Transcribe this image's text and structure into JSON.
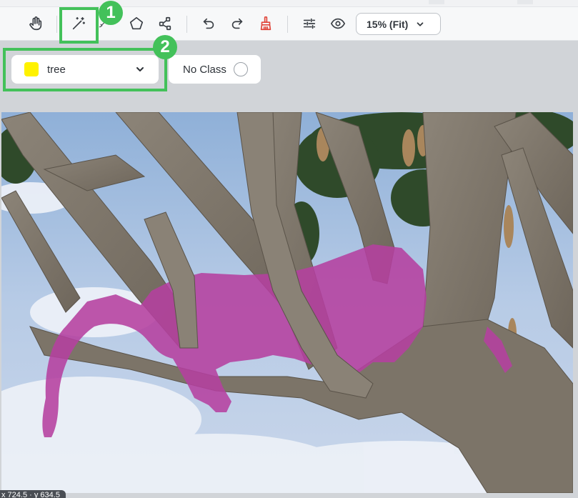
{
  "toolbar": {
    "tools": [
      {
        "name": "pan-tool",
        "icon": "hand-icon"
      },
      {
        "name": "magic-wand-tool",
        "icon": "magic-wand-icon"
      },
      {
        "name": "brush-tool",
        "icon": "brush-icon"
      },
      {
        "name": "polygon-tool",
        "icon": "polygon-icon"
      },
      {
        "name": "keypoint-tool",
        "icon": "nodes-icon"
      },
      {
        "name": "undo-tool",
        "icon": "undo-icon"
      },
      {
        "name": "redo-tool",
        "icon": "redo-icon"
      },
      {
        "name": "clear-tool",
        "icon": "broom-icon"
      },
      {
        "name": "settings-tool",
        "icon": "sliders-icon"
      },
      {
        "name": "visibility-tool",
        "icon": "eye-icon"
      }
    ],
    "zoom_label": "15% (Fit)"
  },
  "class_selector": {
    "selected": "tree",
    "color": "#fff200"
  },
  "no_class": {
    "label": "No Class"
  },
  "annotations": {
    "badge_1": "1",
    "badge_2": "2",
    "highlight_color": "#43c15a"
  },
  "mask_color": "#b5409f",
  "status": {
    "coords": "x 724.5 · y 634.5"
  }
}
